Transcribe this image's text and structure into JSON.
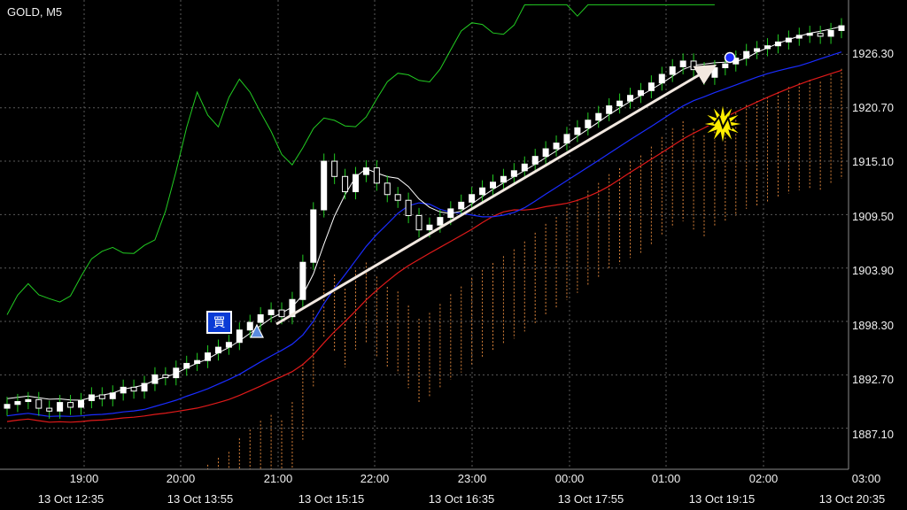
{
  "chart": {
    "title": "GOLD, M5",
    "price_labels": [
      "1926.30",
      "1920.70",
      "1915.10",
      "1909.50",
      "1903.90",
      "1898.30",
      "1892.70",
      "1887.10"
    ],
    "time_labels": [
      "19:00",
      "20:00",
      "21:00",
      "22:00",
      "23:00",
      "00:00",
      "01:00",
      "02:00",
      "03:00"
    ],
    "date_labels": [
      "13 Oct 12:35",
      "13 Oct 13:55",
      "13 Oct 15:15",
      "13 Oct 16:35",
      "13 Oct 17:55",
      "13 Oct 19:15",
      "13 Oct 20:35"
    ],
    "buy_badge_label": "買",
    "colors": {
      "background": "#000000",
      "grid": "#5a5a5a",
      "candle": "#ffffff",
      "bull_candle": "#ffffff",
      "wick": "#22cc22",
      "chikou": "#22cc22",
      "kijun": "#1a2cff",
      "tenkan": "#ffffff",
      "ma": "#e01a1a",
      "cloud": "#d9823a",
      "arrow": "#f2e8e0",
      "burst": "#ffee00"
    }
  },
  "chart_data": {
    "type": "candlestick",
    "symbol": "GOLD",
    "timeframe": "M5",
    "ylim": [
      1882.8,
      1932.0
    ],
    "y_ticks": [
      1926.3,
      1920.7,
      1915.1,
      1909.5,
      1903.9,
      1898.3,
      1892.7,
      1887.1
    ],
    "close_series": [
      1889.6,
      1889.9,
      1890.1,
      1889.2,
      1888.9,
      1889.8,
      1889.3,
      1890.0,
      1890.6,
      1890.2,
      1890.8,
      1891.4,
      1891.0,
      1891.8,
      1892.7,
      1892.4,
      1893.4,
      1893.9,
      1894.2,
      1895.0,
      1895.6,
      1896.1,
      1897.4,
      1898.2,
      1899.0,
      1899.5,
      1898.8,
      1900.6,
      1904.5,
      1910.0,
      1915.1,
      1913.5,
      1911.9,
      1913.7,
      1914.4,
      1912.8,
      1911.6,
      1911.0,
      1909.4,
      1907.9,
      1908.4,
      1909.2,
      1910.1,
      1910.8,
      1911.6,
      1912.3,
      1912.9,
      1913.5,
      1914.1,
      1914.8,
      1915.6,
      1916.4,
      1917.0,
      1917.9,
      1918.6,
      1919.4,
      1920.1,
      1920.9,
      1921.4,
      1922.0,
      1922.5,
      1923.3,
      1924.2,
      1925.0,
      1925.6,
      1924.7,
      1923.9,
      1924.9,
      1925.3,
      1925.9,
      1926.6,
      1926.9,
      1927.2,
      1927.6,
      1928.0,
      1928.3,
      1928.5,
      1928.2,
      1928.8,
      1929.3
    ]
  }
}
